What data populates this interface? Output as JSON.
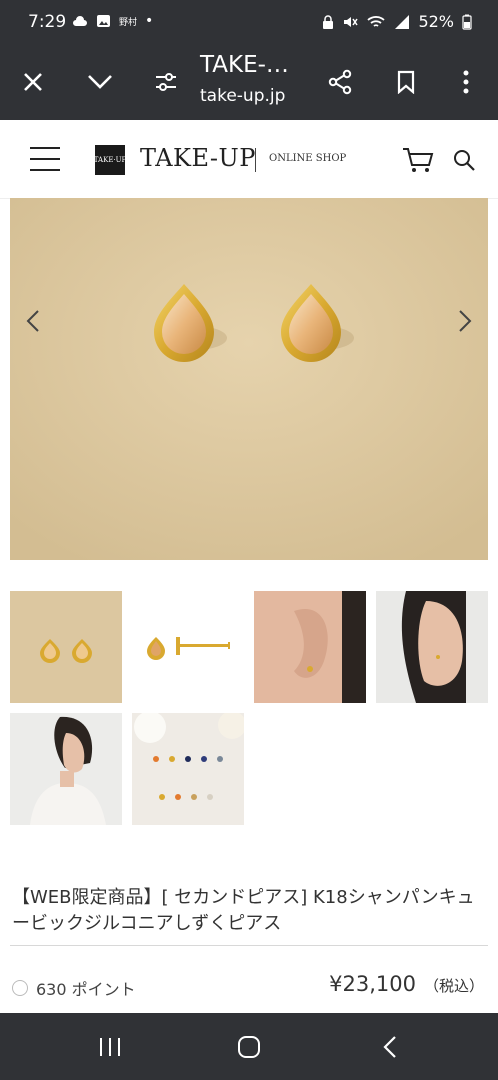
{
  "status_bar": {
    "time": "7:29",
    "carrier_label": "野村",
    "battery": "52%"
  },
  "browser": {
    "title": "TAKE-…",
    "url": "take-up.jp"
  },
  "site_header": {
    "logo_text": "TAKE·UP",
    "brand": "TAKE-UP",
    "shop_label": "ONLINE SHOP"
  },
  "product": {
    "title": "【WEB限定商品】[ セカンドピアス] K18シャンパンキュービックジルコニアしずくピアス",
    "points": "630 ポイント",
    "price": "¥23,100",
    "tax_label": "（税込）"
  },
  "colors": {
    "system_bar": "#303236",
    "hero_background": "#ddc8a0",
    "gold": "#d9a930"
  },
  "icons": [
    "close-icon",
    "chevron-down-icon",
    "tune-icon",
    "share-icon",
    "bookmark-icon",
    "more-vertical-icon",
    "menu-icon",
    "cart-icon",
    "search-icon",
    "arrow-left-icon",
    "arrow-right-icon",
    "recents-icon",
    "home-icon",
    "back-icon"
  ]
}
